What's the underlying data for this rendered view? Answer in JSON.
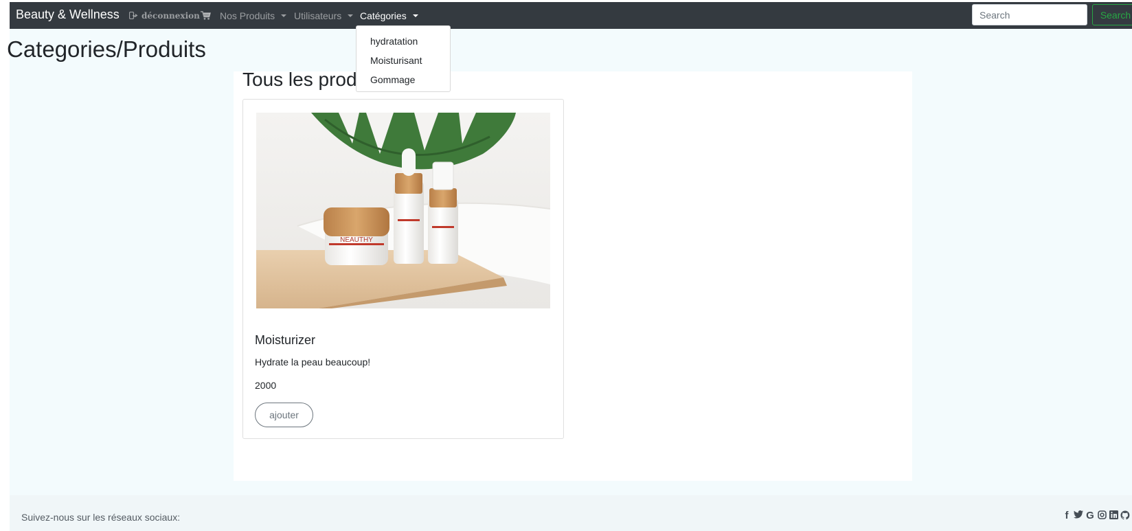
{
  "navbar": {
    "brand": "Beauty & Wellness",
    "logout_label": "déconnexion",
    "logout_icon": "sign-out-icon",
    "cart_icon": "shopping-cart-icon",
    "products_label": "Nos Produits",
    "users_label": "Utilisateurs",
    "categories_label": "Catégories",
    "search_placeholder": "Search",
    "search_button": "Search",
    "bg_color": "#343a40",
    "search_color": "#28a745"
  },
  "dropdown": {
    "items": [
      "hydratation",
      "Moisturisant",
      "Gommage"
    ]
  },
  "page": {
    "title": "Categories/Produits",
    "section_title": "Tous les produits",
    "bg_color": "#f3fbfd"
  },
  "products": [
    {
      "name": "Moisturizer",
      "description": "Hydrate la peau beaucoup!",
      "price": "2000",
      "button": "ajouter",
      "image_label": "NEAUTHY"
    }
  ],
  "footer": {
    "text": "Suivez-nous sur les réseaux sociaux:",
    "social_icons": [
      "facebook-icon",
      "twitter-icon",
      "google-icon",
      "instagram-icon",
      "linkedin-icon",
      "github-icon"
    ]
  }
}
